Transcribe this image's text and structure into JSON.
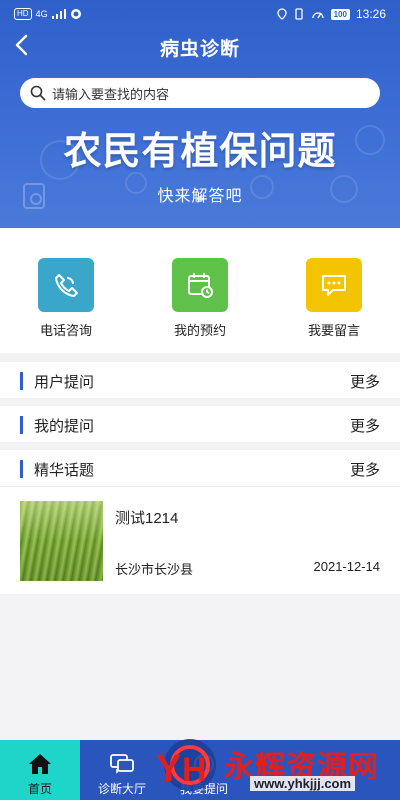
{
  "status": {
    "left_badges": [
      "HD",
      "4G"
    ],
    "battery": "100",
    "time": "13:26"
  },
  "header": {
    "title": "病虫诊断",
    "back_icon": "chevron-left-icon"
  },
  "search": {
    "placeholder": "请输入要查找的内容"
  },
  "banner": {
    "title": "农民有植保问题",
    "subtitle": "快来解答吧"
  },
  "actions": [
    {
      "label": "电话咨询",
      "icon": "phone-icon",
      "color": "#3aa6c9"
    },
    {
      "label": "我的预约",
      "icon": "calendar-icon",
      "color": "#5fc04a"
    },
    {
      "label": "我要留言",
      "icon": "message-icon",
      "color": "#f3c400"
    }
  ],
  "sections": [
    {
      "name": "用户提问",
      "more": "更多"
    },
    {
      "name": "我的提问",
      "more": "更多"
    },
    {
      "name": "精华话题",
      "more": "更多"
    }
  ],
  "topics": [
    {
      "title": "测试1214",
      "location": "长沙市长沙县",
      "date": "2021-12-14"
    }
  ],
  "tabbar": {
    "tabs": [
      {
        "label": "首页",
        "icon": "home-icon",
        "active": true
      },
      {
        "label": "诊断大厅",
        "icon": "chat-icon",
        "active": false
      },
      {
        "label": "我要提问",
        "icon": "question-icon",
        "active": false
      }
    ]
  },
  "watermark": {
    "text": "永辉资源网",
    "url": "www.yhkjjj.com"
  },
  "colors": {
    "primary": "#2f5fc9",
    "tab_active": "#1fd5c9",
    "watermark": "#e02020"
  }
}
